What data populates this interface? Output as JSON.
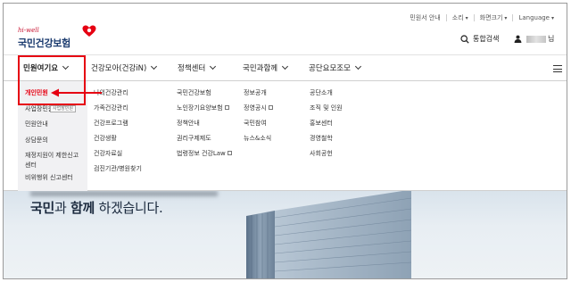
{
  "utility_bar": {
    "items": [
      "민원서 안내",
      "소리",
      "화면크기",
      "Language"
    ]
  },
  "header": {
    "logo_tagline": "hi-well",
    "logo_name": "국민건강보험",
    "search_label": "통합검색",
    "user_suffix": "님"
  },
  "nav": {
    "items": [
      "민원여기요",
      "건강모아(건강iN)",
      "정책센터",
      "국민과함께",
      "공단요모조모"
    ]
  },
  "menu": {
    "col1": [
      "개인민원",
      "사업장민원",
      "민원안내",
      "상담문의",
      "재정지원이 제한신고센터",
      "비위행위 신고센터"
    ],
    "col1_tag": "사업장민원",
    "col2": [
      "나의건강관리",
      "가족건강관리",
      "건강프로그램",
      "건강생활",
      "건강자료실",
      "검진기관/병원찾기"
    ],
    "col3": [
      "국민건강보험",
      "노인장기요양보험",
      "정책안내",
      "권리구제제도",
      "법령정보 건강Law"
    ],
    "col4": [
      "정보공개",
      "정영공시",
      "국민참여",
      "뉴스&소식"
    ],
    "col5": [
      "공단소개",
      "조직 및 인원",
      "홍보센터",
      "경영철학",
      "사회공헌"
    ]
  },
  "hero": {
    "line_bold1": "국민",
    "line_mid1": "과 ",
    "line_bold2": "함께",
    "line_rest": " 하겠습니다."
  },
  "colors": {
    "accent_red": "#e60012",
    "brand_navy": "#1a3a6e"
  }
}
